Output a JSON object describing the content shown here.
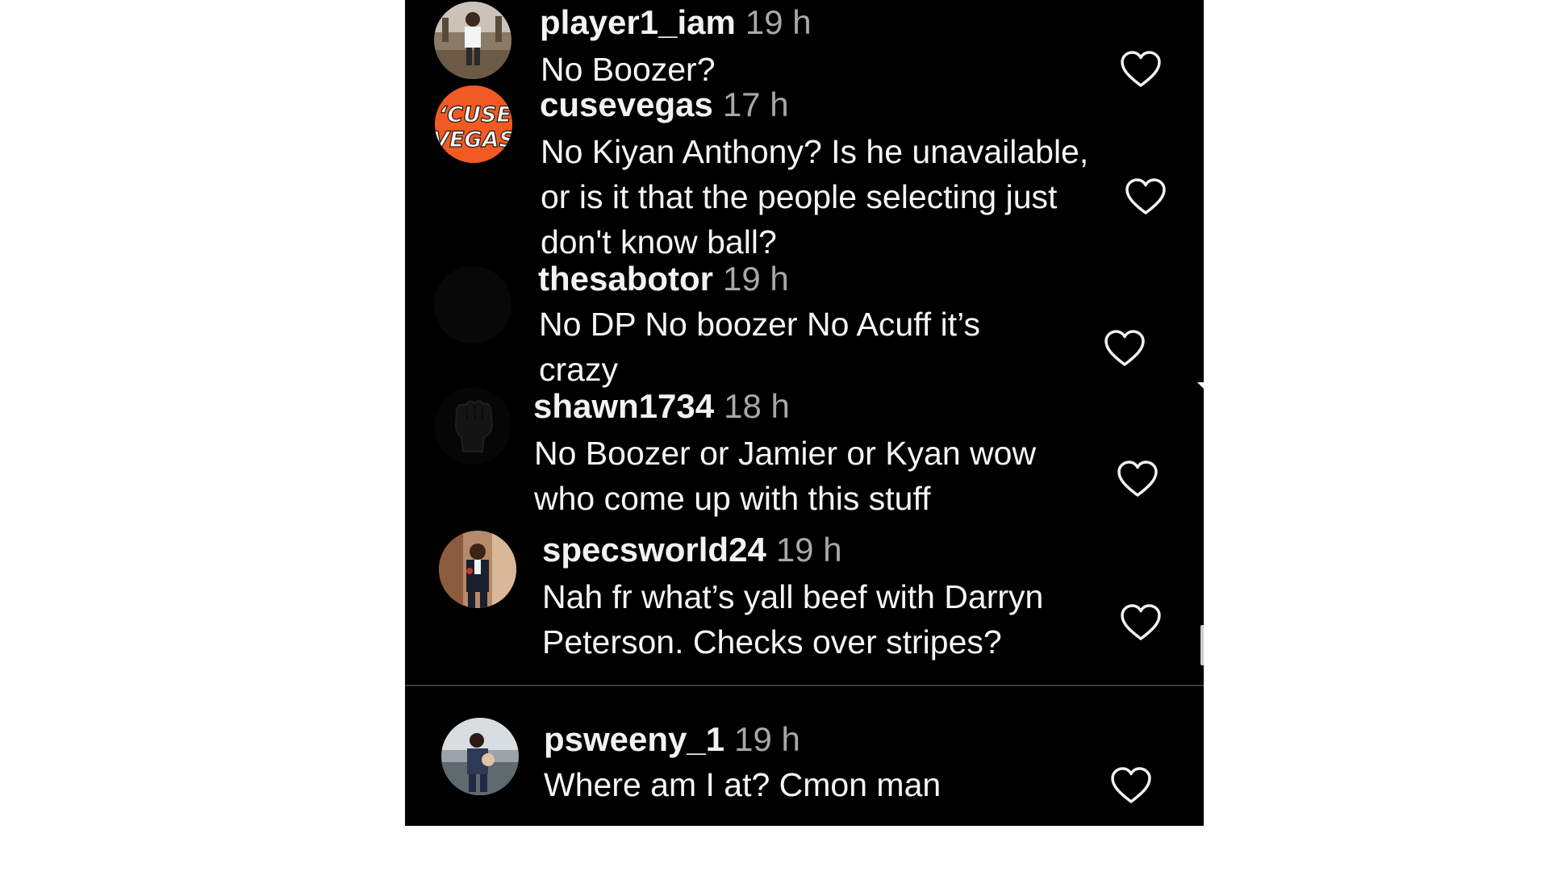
{
  "comments": [
    {
      "username": "player1_iam",
      "time": "19 h",
      "text": "No Boozer?",
      "avatar": "user-photo"
    },
    {
      "username": "cusevegas",
      "time": "17 h",
      "text": "No Kiyan Anthony? Is he unavailable, or is it that the people selecting just don't know ball?",
      "avatar": "cuse-vegas-logo",
      "avatar_text": [
        "‘CUSE",
        "VEGAS"
      ],
      "avatar_color": "#f15a22"
    },
    {
      "username": "thesabotor",
      "time": "19 h",
      "text": "No DP No boozer No Acuff it’s crazy",
      "avatar": "dark-avatar"
    },
    {
      "username": "shawn1734",
      "time": "18 h",
      "text": "No Boozer or Jamier or Kyan wow who come up with this stuff",
      "avatar": "fist-icon"
    },
    {
      "username": "specsworld24",
      "time": "19 h",
      "text": "Nah fr what’s yall beef with Darryn Peterson. Checks over stripes?",
      "avatar": "user-photo"
    },
    {
      "username": "psweeny_1",
      "time": "19 h",
      "text": "Where am I at? Cmon man",
      "avatar": "user-photo"
    }
  ],
  "like_icon": "heart-outline-icon",
  "colors": {
    "background": "#000000",
    "text": "#ffffff",
    "timestamp": "#a8a8a8",
    "page": "#ffffff"
  }
}
